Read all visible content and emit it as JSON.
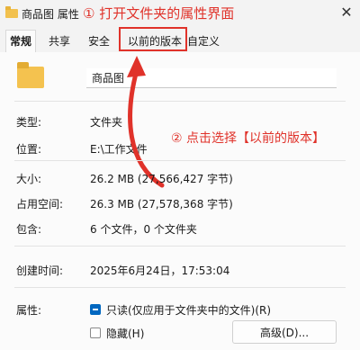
{
  "window": {
    "title": "商品图 属性",
    "close_glyph": "✕"
  },
  "annotations": {
    "step1": "① 打开文件夹的属性界面",
    "step2": "② 点击选择【以前的版本】",
    "accent_color": "#e0322a"
  },
  "tabs": [
    {
      "label": "常规",
      "active": true
    },
    {
      "label": "共享",
      "active": false
    },
    {
      "label": "安全",
      "active": false
    },
    {
      "label": "以前的版本",
      "active": false
    },
    {
      "label": "自定义",
      "active": false
    }
  ],
  "general": {
    "folder_name": "商品图",
    "type": {
      "label": "类型:",
      "value": "文件夹"
    },
    "location": {
      "label": "位置:",
      "value": "E:\\工作文件"
    },
    "size": {
      "label": "大小:",
      "value": "26.2 MB (27,566,427 字节)"
    },
    "size_on_disk": {
      "label": "占用空间:",
      "value": "26.3 MB (27,578,368 字节)"
    },
    "contains": {
      "label": "包含:",
      "value": "6 个文件，0 个文件夹"
    },
    "created": {
      "label": "创建时间:",
      "value": "2025年6月24日，17:53:04"
    },
    "attributes": {
      "label": "属性:",
      "readonly_label": "只读(仅应用于文件夹中的文件)(R)",
      "readonly_state": "indeterminate",
      "hidden_label": "隐藏(H)",
      "hidden_state": "unchecked",
      "advanced_button": "高级(D)..."
    }
  }
}
